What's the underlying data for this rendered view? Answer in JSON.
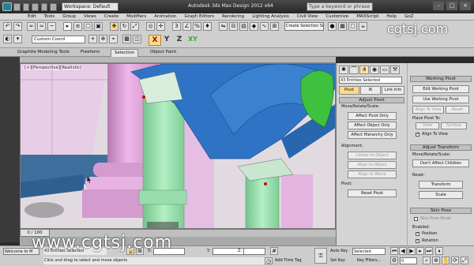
{
  "titlebar": {
    "workspace": "Workspace: Default",
    "title": "Autodesk 3ds Max Design 2012 x64",
    "search_placeholder": "Type a keyword or phrase",
    "controls": [
      "–",
      "□",
      "×"
    ]
  },
  "menu": [
    "Edit",
    "Tools",
    "Group",
    "Views",
    "Create",
    "Modifiers",
    "Animation",
    "Graph Editors",
    "Rendering",
    "Lighting Analysis",
    "Civil View",
    "Customize",
    "MAXScript",
    "Help",
    "GoZ"
  ],
  "toolbar": {
    "selection_set": "Create Selection Se",
    "coord_system": "Custom Coord",
    "axis": [
      "X",
      "Y",
      "Z",
      "XY"
    ]
  },
  "ribbon": {
    "tabs": [
      "Graphite Modeling Tools",
      "Freeform",
      "Selection",
      "Object Paint"
    ],
    "active": "Selection"
  },
  "viewport": {
    "label": "[+][Perspective][Realistic]"
  },
  "command_panel": {
    "name_field": "43 Entities Selected",
    "pivot_tabs": [
      "Pivot",
      "IK",
      "Link Info"
    ],
    "adjust_pivot_title": "Adjust Pivot",
    "move_rotate_label": "Move/Rotate/Scale:",
    "affect_pivot_only": "Affect Pivot Only",
    "affect_object_only": "Affect Object Only",
    "affect_hierarchy_only": "Affect Hierarchy Only",
    "alignment_label": "Alignment:",
    "center_to_object": "Center to Object",
    "align_to_object": "Align to Object",
    "align_to_world": "Align to World",
    "pivot_label": "Pivot:",
    "reset_pivot": "Reset Pivot"
  },
  "right_panel": {
    "working_pivot": "Working Pivot",
    "edit_working_pivot": "Edit Working Pivot",
    "use_working_pivot": "Use Working Pivot",
    "align_to_view": "Align To View",
    "reset": "Reset",
    "place_pivot_to": "Place Pivot To:",
    "view": "View",
    "surface": "Surface",
    "align_to_view_check": "Align To View",
    "adjust_transform": "Adjust Transform",
    "move_rotate_scale": "Move/Rotate/Scale:",
    "dont_affect_children": "Don't Affect Children",
    "reset_label": "Reset:",
    "transform": "Transform",
    "scale": "Scale",
    "skin_pose": "Skin Pose",
    "skin_pose_mode": "Skin Pose Mode",
    "enabled": "Enabled:",
    "position": "Position",
    "rotation": "Rotation"
  },
  "timeline": {
    "slider": "0 / 100"
  },
  "status": {
    "listener": "Welcome to M",
    "selected": "43 Entities Selected",
    "prompt": "Click and drag to select and move objects",
    "x_label": "X:",
    "y_label": "Y:",
    "z_label": "Z:",
    "add_time_tag": "Add Time Tag",
    "auto_key": "Auto Key",
    "set_key": "Set Key",
    "selected_dropdown": "Selected",
    "key_filters": "Key Filters...",
    "frame": "0"
  },
  "watermark": "www.cgtsj.com",
  "watermark_top": "cgtsj.com",
  "colors": {
    "pink": "#e4a9df",
    "blue": "#2f74c4",
    "green": "#8fd8a3",
    "bright_green": "#3ec13e"
  }
}
